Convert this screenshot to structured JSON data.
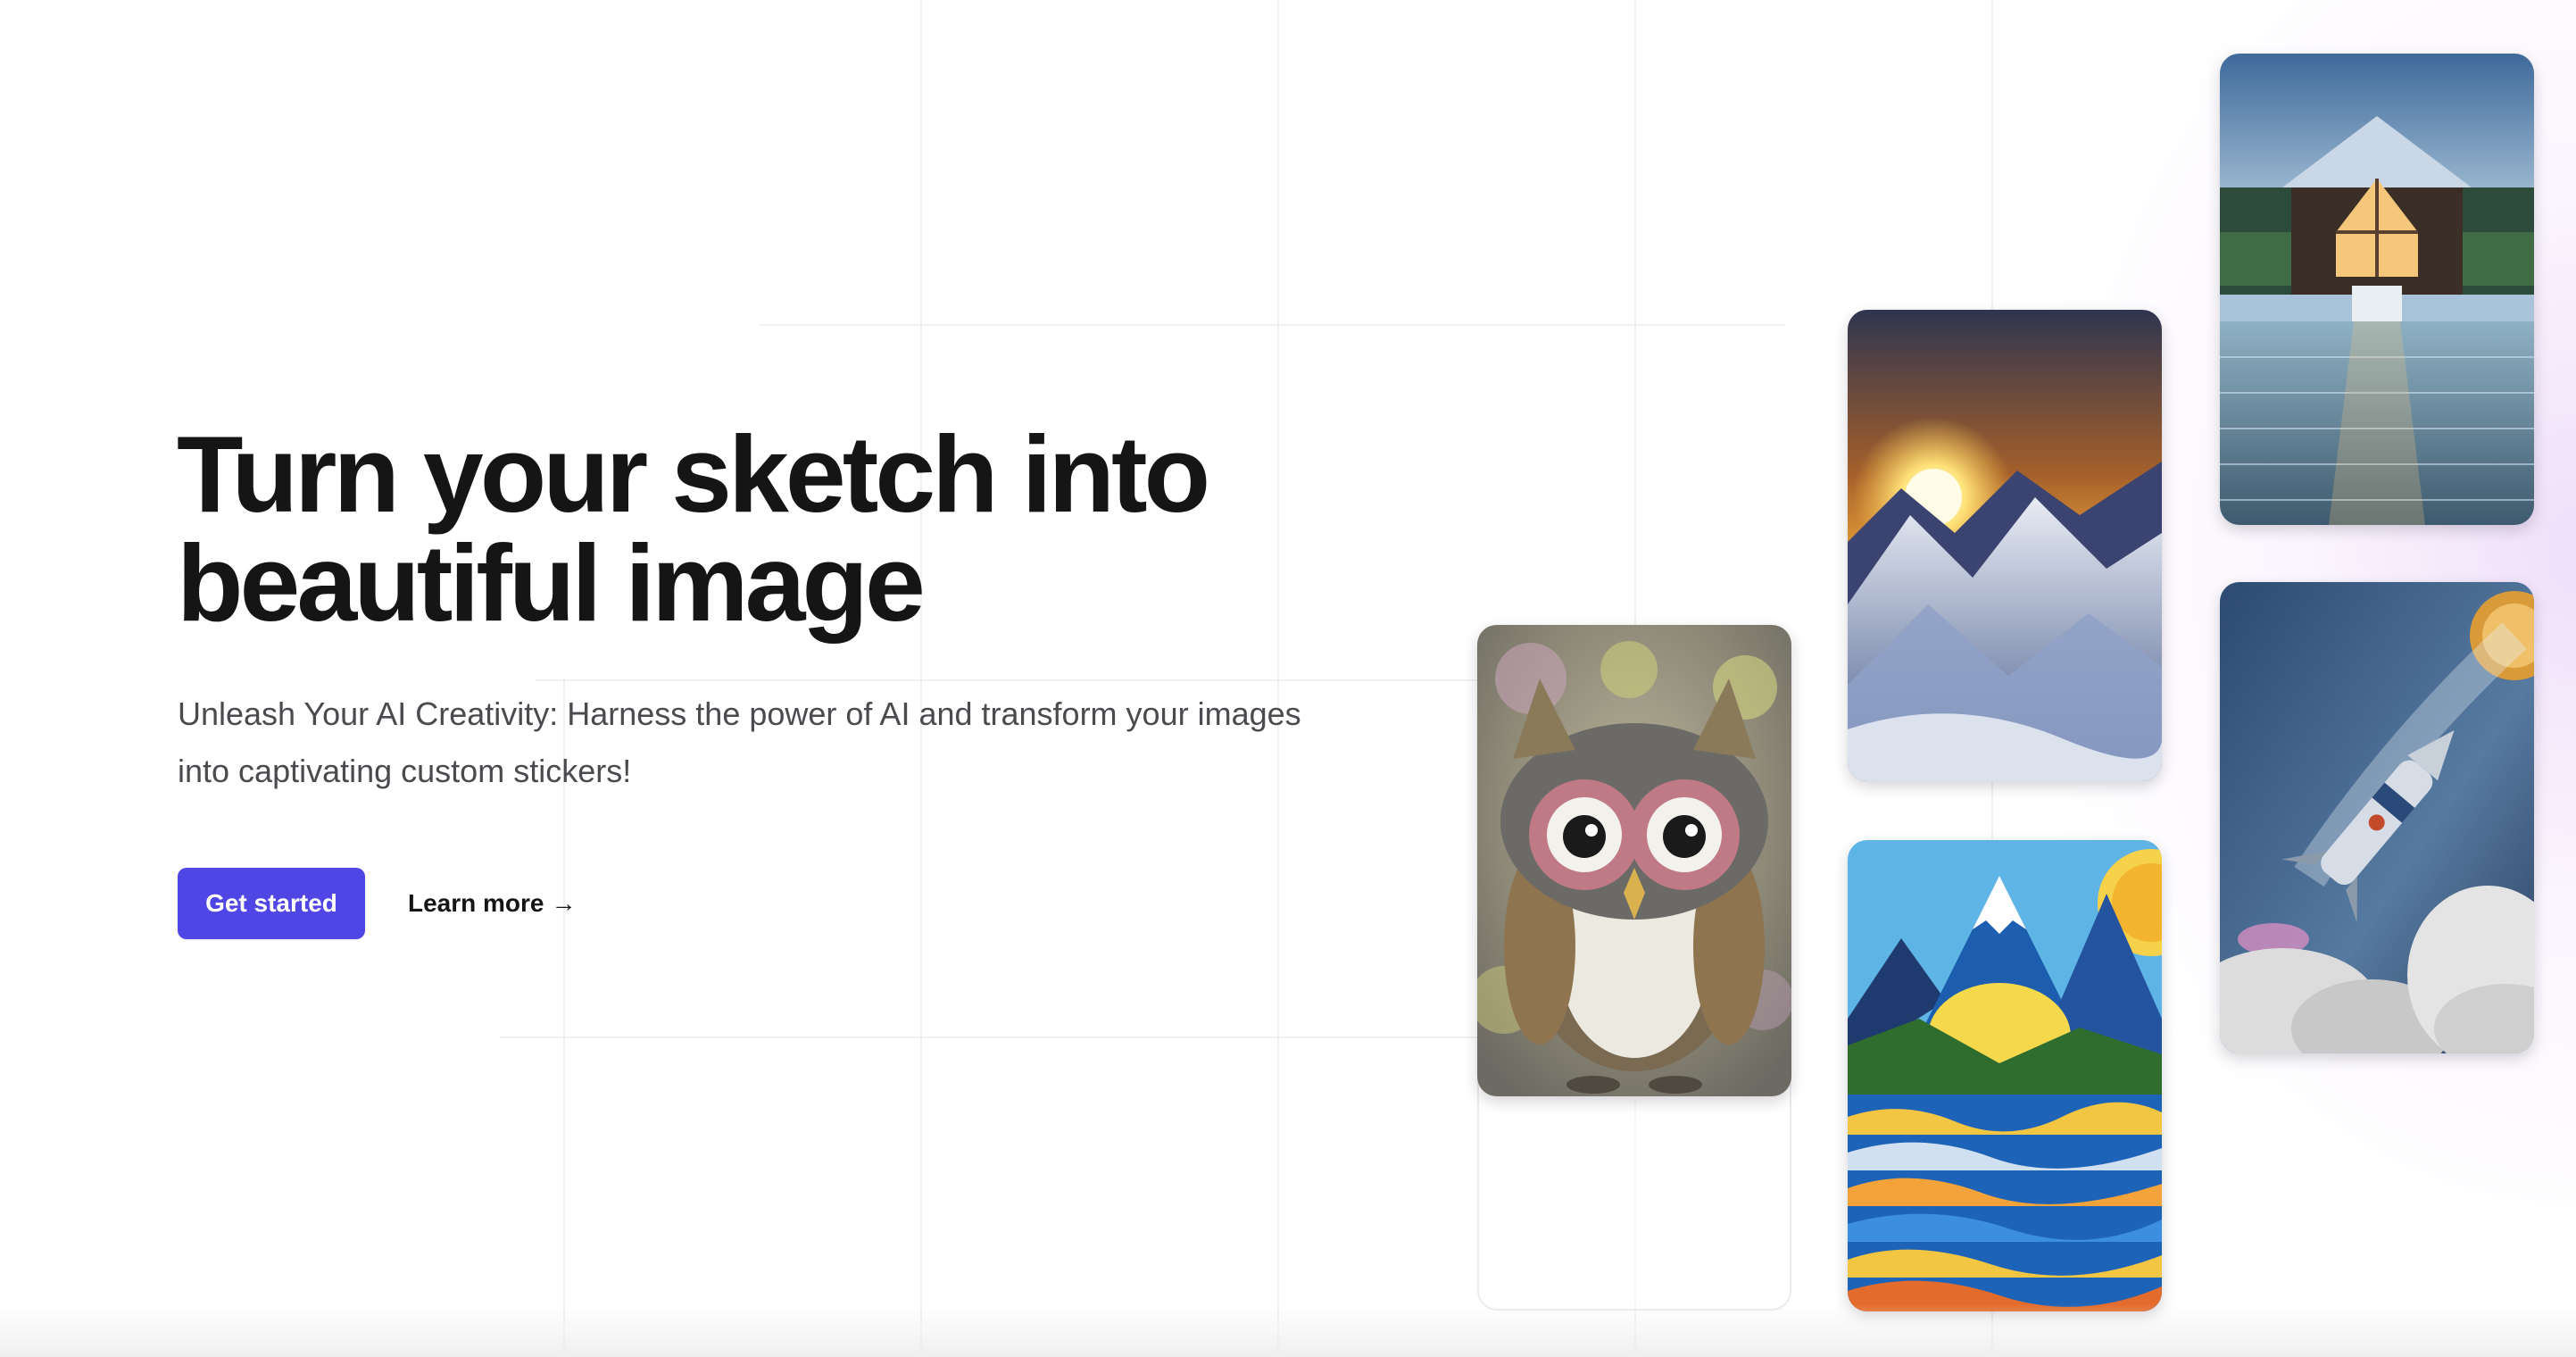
{
  "hero": {
    "title_line1": "Turn your sketch into",
    "title_line2": "beautiful image",
    "subtitle_line1": "Unleash Your AI Creativity: Harness the power of AI and transform your images",
    "subtitle_line2": "into captivating custom stickers!"
  },
  "cta": {
    "primary_label": "Get started",
    "secondary_label": "Learn more",
    "secondary_arrow": "→"
  },
  "gallery": {
    "images": [
      {
        "subject": "owl"
      },
      {
        "subject": "sunset-mountains"
      },
      {
        "subject": "mountains-lake"
      },
      {
        "subject": "cabin-on-water"
      },
      {
        "subject": "rocket-launch"
      }
    ]
  },
  "colors": {
    "accent": "#4f46e5",
    "title": "#151515",
    "subtitle": "#4a4a4f",
    "background": "#ffffff"
  }
}
